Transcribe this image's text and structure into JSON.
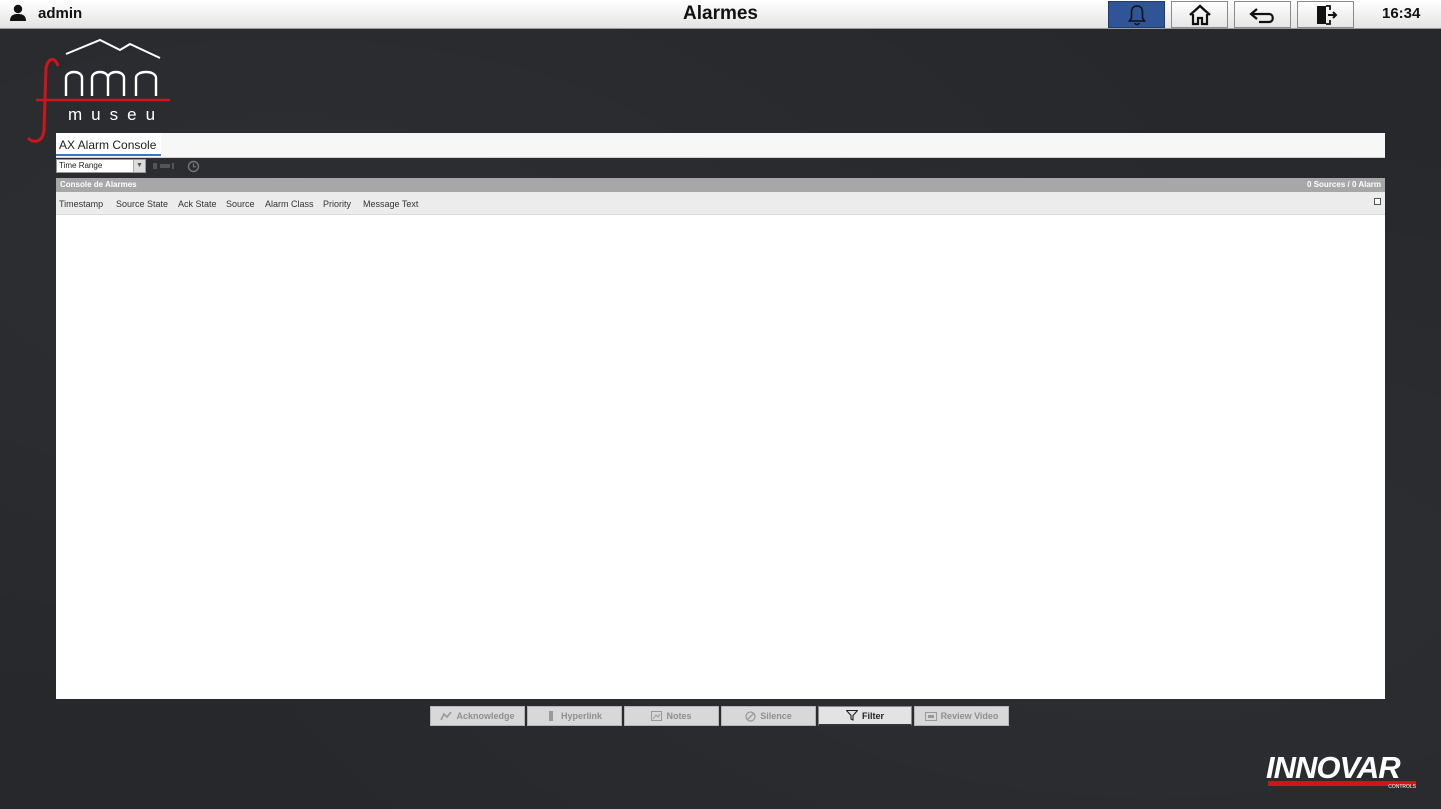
{
  "header": {
    "username": "admin",
    "title": "Alarmes",
    "clock": "16:34",
    "nav_buttons": [
      {
        "name": "alarms",
        "icon": "bell-icon",
        "active": true
      },
      {
        "name": "home",
        "icon": "home-icon",
        "active": false
      },
      {
        "name": "back",
        "icon": "back-arrow-icon",
        "active": false
      },
      {
        "name": "logout",
        "icon": "logout-icon",
        "active": false
      }
    ]
  },
  "logo": {
    "text": "museu",
    "icon": "fmn-museu-logo"
  },
  "console": {
    "tab_label": "AX Alarm Console",
    "time_range_label": "Time Range",
    "title": "Console de Alarmes",
    "summary": "0 Sources / 0 Alarm",
    "columns": [
      "Timestamp",
      "Source State",
      "Ack State",
      "Source",
      "Alarm Class",
      "Priority",
      "Message Text"
    ],
    "rows": []
  },
  "actions": [
    {
      "label": "Acknowledge",
      "icon": "acknowledge-icon",
      "enabled": false
    },
    {
      "label": "Hyperlink",
      "icon": "hyperlink-icon",
      "enabled": false
    },
    {
      "label": "Notes",
      "icon": "notes-icon",
      "enabled": false
    },
    {
      "label": "Silence",
      "icon": "silence-icon",
      "enabled": false
    },
    {
      "label": "Filter",
      "icon": "filter-icon",
      "enabled": true
    },
    {
      "label": "Review Video",
      "icon": "video-icon",
      "enabled": false
    }
  ],
  "footer_logo": {
    "text": "INNOVAR",
    "subtext": "CONTROLS"
  },
  "colors": {
    "accent": "#2f5597",
    "brand_red": "#d0141c",
    "background": "#26282c"
  }
}
